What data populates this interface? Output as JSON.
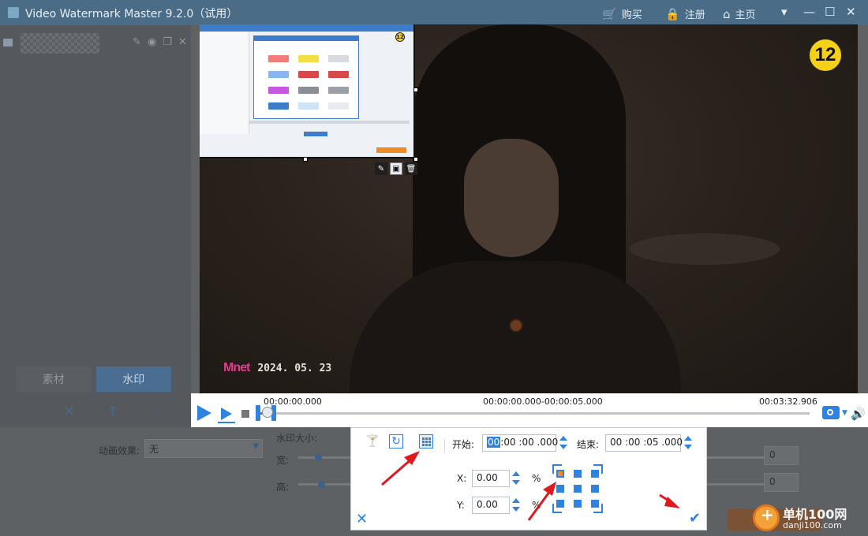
{
  "app": {
    "title": "Video Watermark Master 9.2.0（试用）",
    "buy_label": "购买",
    "register_label": "注册",
    "home_label": "主页"
  },
  "left_panel": {
    "tabs": [
      {
        "label": "素材",
        "active": false
      },
      {
        "label": "水印",
        "active": true
      }
    ]
  },
  "properties": {
    "animation_label": "动画效果:",
    "animation_value": "无",
    "watermark_size_label": "水印大小:",
    "width_label": "宽:",
    "height_label": "高:",
    "width_value": "0",
    "height_value": "0"
  },
  "video": {
    "badge_number": "12",
    "channel_logo": "Mnet",
    "date_overlay": "2024. 05. 23",
    "watermark_badge": "12"
  },
  "timeline": {
    "current_time": "00:00:00.000",
    "range_time": "00:00:00.000-00:00:05.000",
    "total_time": "00:03:32.906"
  },
  "position_dialog": {
    "start_label": "开始:",
    "start_hl": "00",
    "start_rest": ":00 :00 .000",
    "end_label": "结束:",
    "end_value": "00 :00 :05 .000",
    "x_label": "X:",
    "x_value": "0.00",
    "y_label": "Y:",
    "y_value": "0.00",
    "percent": "%",
    "selected_anchor": "top-left"
  },
  "site_watermark": {
    "name": "单机100网",
    "url": "danji100.com"
  },
  "colors": {
    "accent": "#2f82de",
    "titlebar": "#4a6c86",
    "highlight_arrow": "#e0191e",
    "selected_anchor": "#f08a24"
  }
}
